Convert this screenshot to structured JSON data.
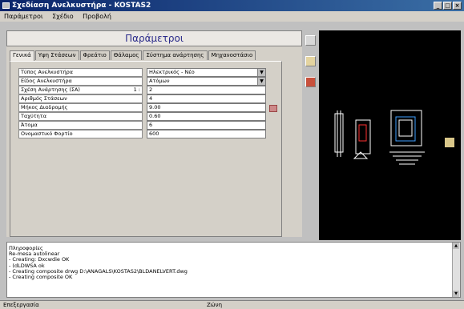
{
  "window": {
    "title": "Σχεδίαση Ανελκυστήρα - KOSTAS2"
  },
  "menu": [
    "Παράμετροι",
    "Σχέδιο",
    "Προβολή"
  ],
  "panel": {
    "title": "Παράμετροι"
  },
  "tabs": [
    "Γενικά",
    "Υψη Στάσεων",
    "Φρεάτιο",
    "Θάλαμος",
    "Σύστημα ανάρτησης",
    "Μηχανοστάσιο"
  ],
  "form": {
    "rows": [
      {
        "label": "Τύπος Ανελκυστήρα",
        "value": "Ηλεκτρικός - Νέο",
        "dropdown": true
      },
      {
        "label": "Είδος Ανελκυστήρα",
        "value": "Ατόμων",
        "dropdown": true
      },
      {
        "label": "Σχέση Ανάρτησης (ΣΑ)",
        "mark": "1 :",
        "value": "2"
      },
      {
        "label": "Αριθμός Στάσεων",
        "value": "4"
      },
      {
        "label": "Μήκος Διαδρομής",
        "value": "9.00",
        "calendar": true
      },
      {
        "label": "Ταχύτητα",
        "value": "0.60"
      },
      {
        "label": "Άτομα",
        "value": "6"
      },
      {
        "label": "Ονομαστικό Φορτίο",
        "value": "600"
      }
    ]
  },
  "console": {
    "lines": [
      "Πληροφορίες",
      "Re-mesa autolinear",
      "- Creating: Dxcwdie OK",
      "- (dLDWSA ok",
      "- Creating composite drwg D:\\ANAGALS\\KOSTAS2\\BLDANELVERT.dwg",
      "- Creating composite OK"
    ]
  },
  "status": {
    "left": "Επεξεργασία",
    "middle": "Ζώνη"
  },
  "colors": {
    "titlebar": "#0a246a",
    "preview_bg": "#000000",
    "panel_title": "#2a2a8a"
  }
}
